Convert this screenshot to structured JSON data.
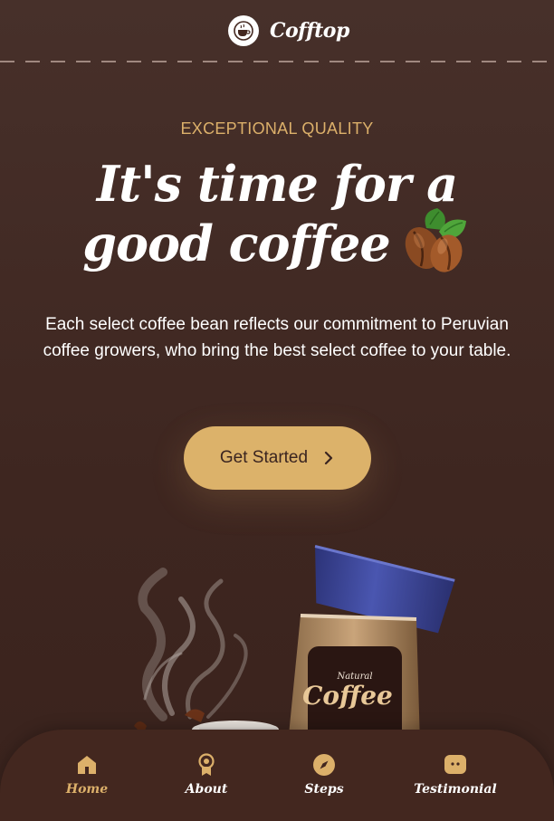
{
  "brand": {
    "name": "Cofftop",
    "logo_icon": "coffee-cup-icon"
  },
  "hero": {
    "eyebrow": "EXCEPTIONAL QUALITY",
    "headline_line1": "It's time for a",
    "headline_line2": "good coffee",
    "headline_icon": "coffee-beans-icon",
    "description": "Each select coffee bean reflects our commitment to Peruvian coffee growers, who bring the best select coffee to your table.",
    "cta_label": "Get Started",
    "cta_icon": "chevron-right-icon"
  },
  "product": {
    "label_small": "Natural",
    "label_large": "Coffee"
  },
  "nav": {
    "active": "Home",
    "items": [
      {
        "label": "Home",
        "icon": "home-icon"
      },
      {
        "label": "About",
        "icon": "award-icon"
      },
      {
        "label": "Steps",
        "icon": "compass-icon"
      },
      {
        "label": "Testimonial",
        "icon": "chat-icon"
      }
    ]
  },
  "colors": {
    "background": "#432922",
    "accent": "#dcb26a",
    "text": "#ffffff",
    "nav_background": "#43271f"
  }
}
